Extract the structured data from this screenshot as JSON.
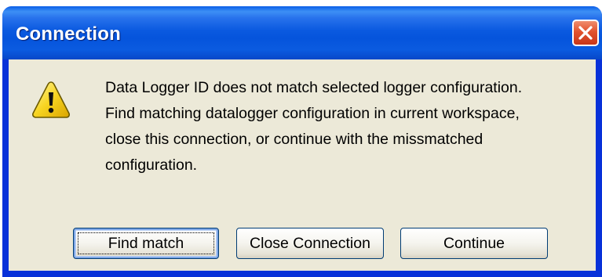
{
  "dialog": {
    "title": "Connection",
    "icon": "warning-icon",
    "message_lines": [
      "Data Logger ID does not match selected logger configuration.",
      "Find matching datalogger configuration in current workspace,",
      "close this connection, or continue with the missmatched",
      "configuration."
    ],
    "buttons": {
      "find_match": "Find match",
      "close_connection": "Close Connection",
      "continue": "Continue"
    }
  },
  "colors": {
    "titlebar": "#0554dc",
    "close_button": "#e2522d",
    "client_background": "#ece9d8",
    "button_border": "#003c74"
  }
}
